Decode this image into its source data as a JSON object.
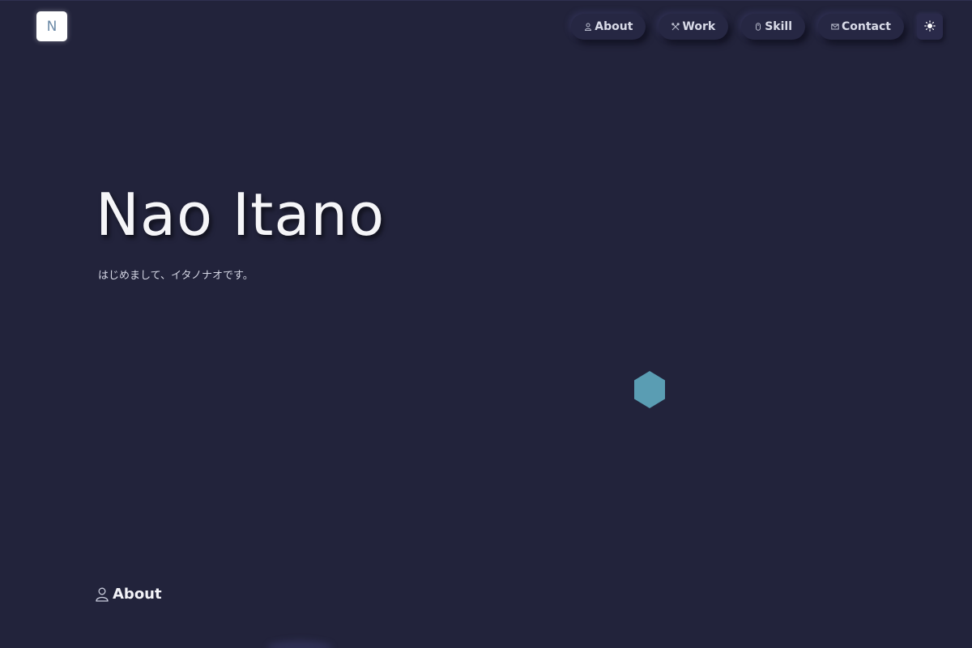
{
  "logo": {
    "letter": "N"
  },
  "nav": {
    "items": [
      {
        "label": "About",
        "icon": "user-icon"
      },
      {
        "label": "Work",
        "icon": "tools-icon"
      },
      {
        "label": "Skill",
        "icon": "mouse-icon"
      },
      {
        "label": "Contact",
        "icon": "mail-icon"
      }
    ],
    "theme_toggle_icon": "sun-icon"
  },
  "hero": {
    "name": "Nao Itano",
    "subtitle": "はじめまして、イタノナオです。"
  },
  "decoration": {
    "hexagon_color": "#5a9db3"
  },
  "section": {
    "label": "About",
    "icon": "user-icon"
  },
  "colors": {
    "background": "#22233b",
    "text": "#f5f5f8",
    "button_bg": "#262743"
  }
}
